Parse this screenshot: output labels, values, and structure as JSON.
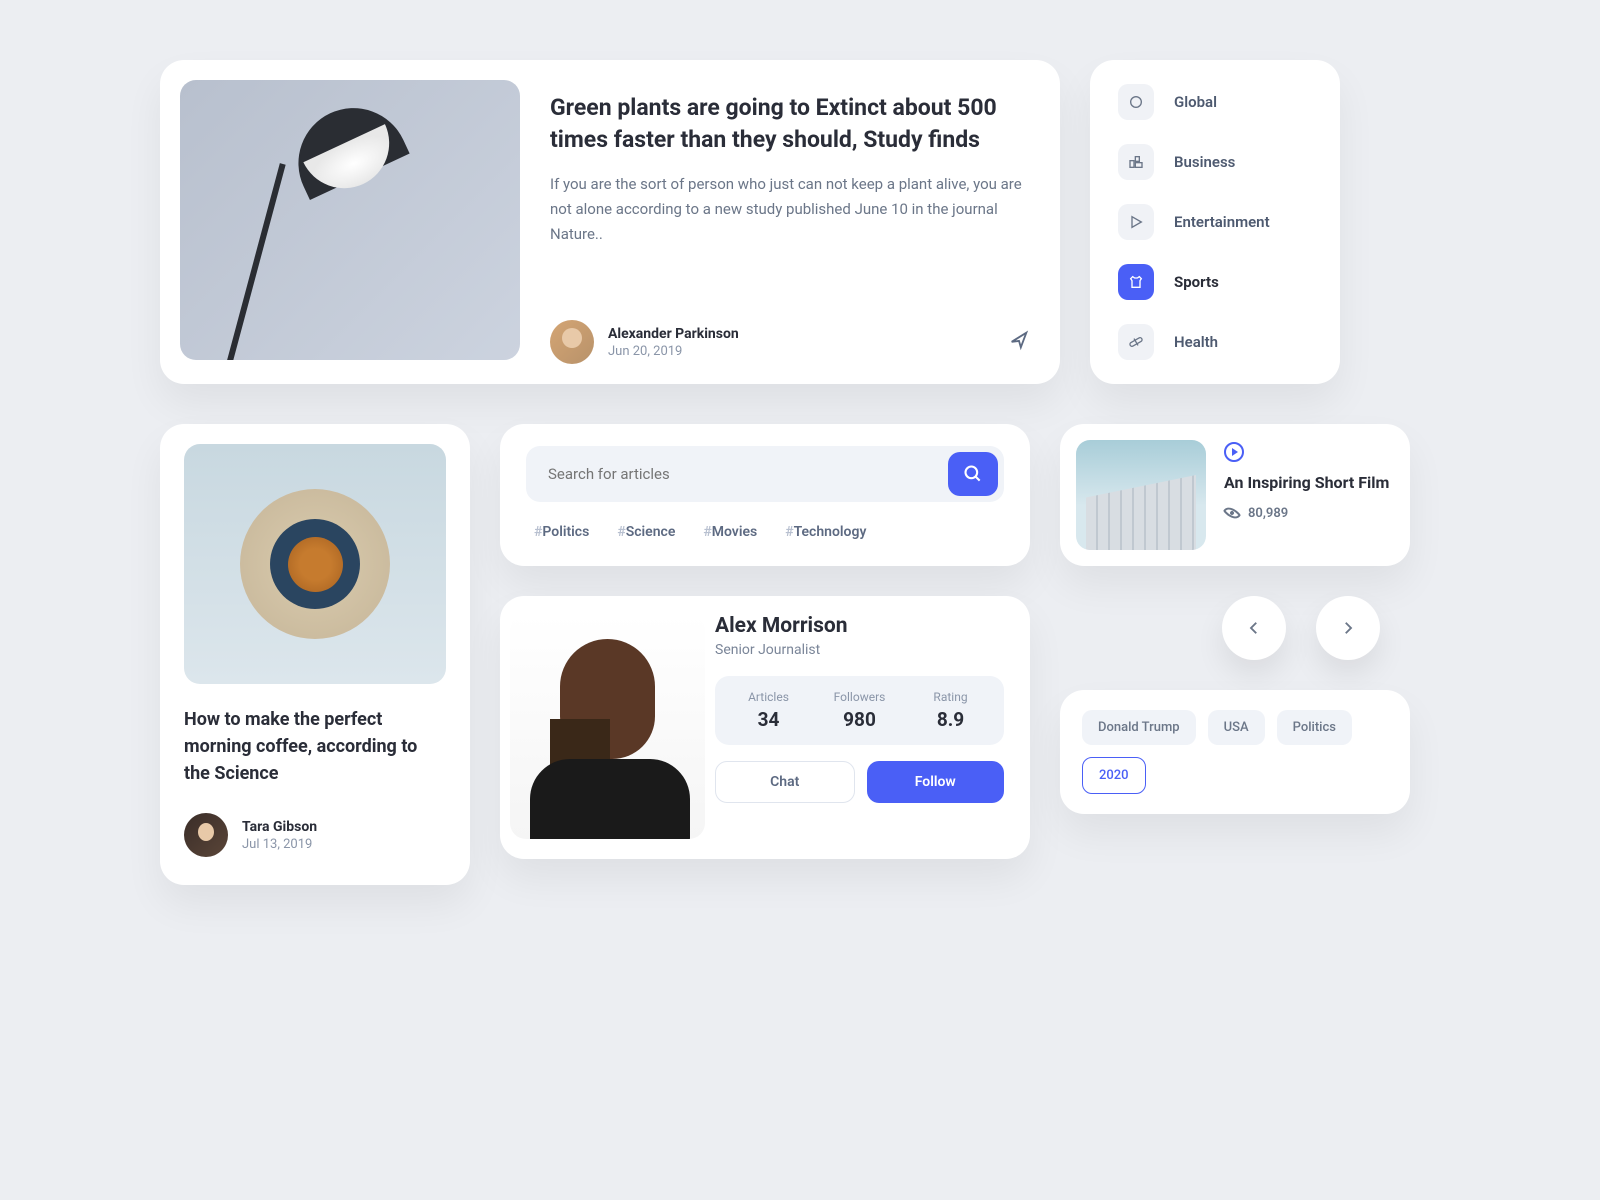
{
  "featured": {
    "title": "Green plants are going to Extinct about 500 times faster than they should, Study finds",
    "excerpt": "If you are the sort of person who just can not keep a plant alive, you are not alone according to a new study published June 10 in the journal Nature..",
    "author": "Alexander Parkinson",
    "date": "Jun 20, 2019"
  },
  "categories": [
    {
      "label": "Global",
      "icon": "circle",
      "active": false
    },
    {
      "label": "Business",
      "icon": "chart",
      "active": false
    },
    {
      "label": "Entertainment",
      "icon": "play",
      "active": false
    },
    {
      "label": "Sports",
      "icon": "jersey",
      "active": true
    },
    {
      "label": "Health",
      "icon": "pill",
      "active": false
    }
  ],
  "coffee": {
    "title": "How to make the perfect morning coffee, according to the Science",
    "author": "Tara Gibson",
    "date": "Jul 13, 2019"
  },
  "search": {
    "placeholder": "Search for articles",
    "tags": [
      "Politics",
      "Science",
      "Movies",
      "Technology"
    ]
  },
  "profile": {
    "name": "Alex Morrison",
    "role": "Senior Journalist",
    "stats": [
      {
        "label": "Articles",
        "value": "34"
      },
      {
        "label": "Followers",
        "value": "980"
      },
      {
        "label": "Rating",
        "value": "8.9"
      }
    ],
    "chat_label": "Chat",
    "follow_label": "Follow"
  },
  "video": {
    "title": "An Inspiring Short Film",
    "views": "80,989"
  },
  "chips": [
    {
      "label": "Donald Trump",
      "active": false
    },
    {
      "label": "USA",
      "active": false
    },
    {
      "label": "Politics",
      "active": false
    },
    {
      "label": "2020",
      "active": true
    }
  ]
}
